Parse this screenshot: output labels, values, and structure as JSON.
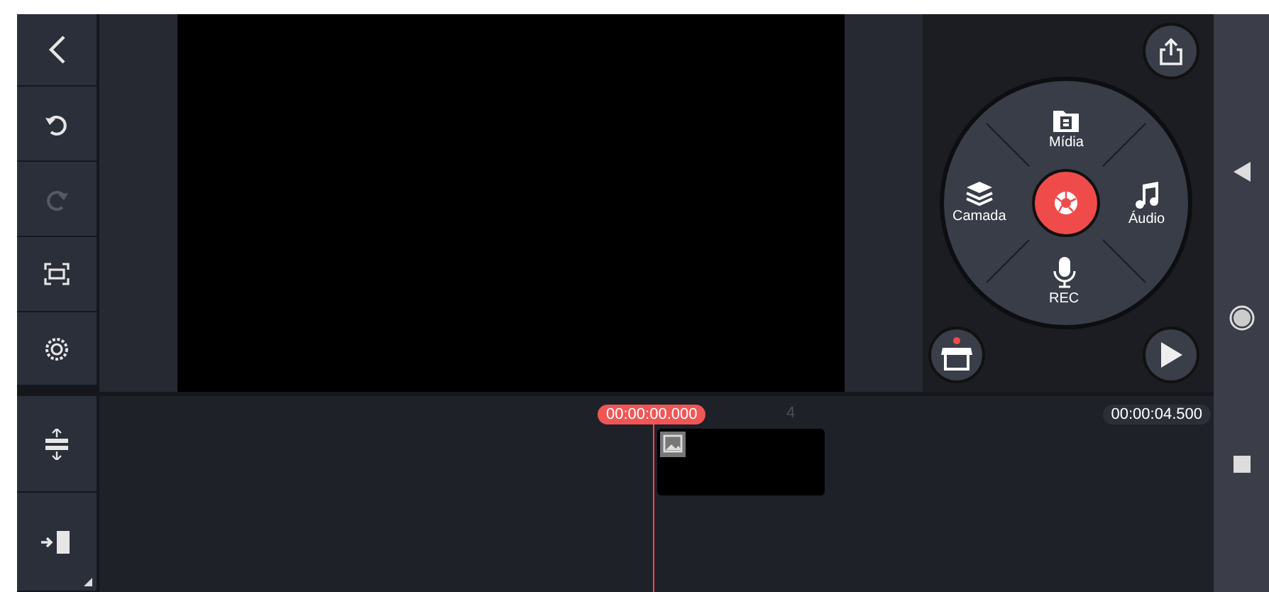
{
  "toolbar": [
    {
      "kind": "back",
      "disabled": false
    },
    {
      "kind": "undo",
      "disabled": false
    },
    {
      "kind": "redo",
      "disabled": true
    },
    {
      "kind": "fullscreen",
      "disabled": false
    },
    {
      "kind": "settings",
      "disabled": false
    }
  ],
  "timeline_tools": [
    {
      "kind": "split"
    },
    {
      "kind": "enter"
    }
  ],
  "media_wheel": [
    {
      "kind": "media",
      "label": "Mídia"
    },
    {
      "kind": "layer",
      "label": "Camada"
    },
    {
      "kind": "audio",
      "label": "Áudio"
    },
    {
      "kind": "rec",
      "label": "REC"
    }
  ],
  "store": {
    "has_notification": true
  },
  "timeline": {
    "current_time": "00:00:00.000",
    "ruler_mark": "4",
    "total_time": "00:00:04.500"
  }
}
